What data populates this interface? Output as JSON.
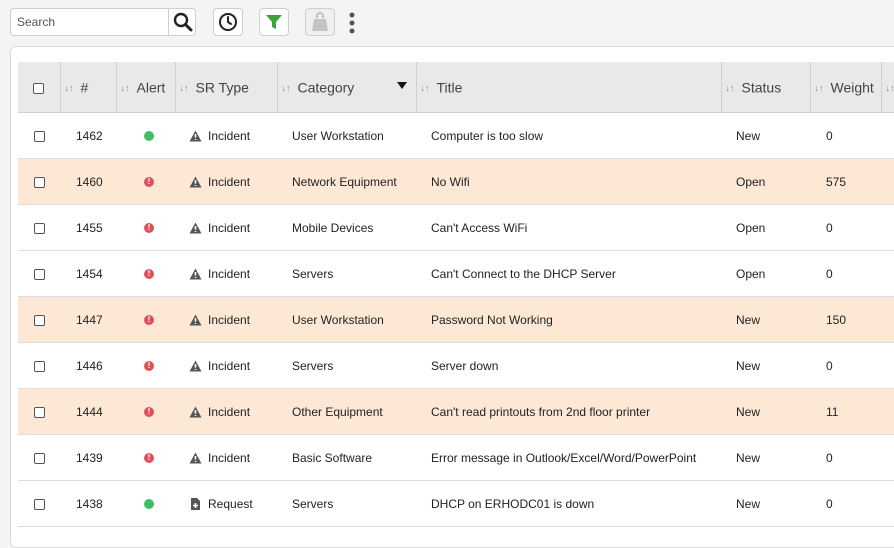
{
  "toolbar": {
    "search_placeholder": "Search",
    "buttons": [
      "search-icon",
      "clock-icon",
      "filter-icon",
      "bag-icon",
      "more-icon"
    ],
    "filter_color": "#3aa63a"
  },
  "table": {
    "headers": {
      "num": "#",
      "alert": "Alert",
      "sr_type": "SR Type",
      "category": "Category",
      "title": "Title",
      "status": "Status",
      "weight": "Weight"
    },
    "rows": [
      {
        "num": "1462",
        "alert": "green",
        "type": "Incident",
        "category": "User Workstation",
        "title": "Computer is too slow",
        "status": "New",
        "weight": "0",
        "highlight": false
      },
      {
        "num": "1460",
        "alert": "red",
        "type": "Incident",
        "category": "Network Equipment",
        "title": "No Wifi",
        "status": "Open",
        "weight": "575",
        "highlight": true
      },
      {
        "num": "1455",
        "alert": "red",
        "type": "Incident",
        "category": "Mobile Devices",
        "title": "Can't Access WiFi",
        "status": "Open",
        "weight": "0",
        "highlight": false
      },
      {
        "num": "1454",
        "alert": "red",
        "type": "Incident",
        "category": "Servers",
        "title": "Can't Connect to the DHCP Server",
        "status": "Open",
        "weight": "0",
        "highlight": false
      },
      {
        "num": "1447",
        "alert": "red",
        "type": "Incident",
        "category": "User Workstation",
        "title": "Password Not Working",
        "status": "New",
        "weight": "150",
        "highlight": true
      },
      {
        "num": "1446",
        "alert": "red",
        "type": "Incident",
        "category": "Servers",
        "title": "Server down",
        "status": "New",
        "weight": "0",
        "highlight": false
      },
      {
        "num": "1444",
        "alert": "red",
        "type": "Incident",
        "category": "Other Equipment",
        "title": "Can't read printouts from 2nd floor printer",
        "status": "New",
        "weight": "11",
        "highlight": true
      },
      {
        "num": "1439",
        "alert": "red",
        "type": "Incident",
        "category": "Basic Software",
        "title": "Error message in Outlook/Excel/Word/PowerPoint",
        "status": "New",
        "weight": "0",
        "highlight": false
      },
      {
        "num": "1438",
        "alert": "green",
        "type": "Request",
        "category": "Servers",
        "title": "DHCP on ERHODC01 is down",
        "status": "New",
        "weight": "0",
        "highlight": false
      }
    ]
  }
}
